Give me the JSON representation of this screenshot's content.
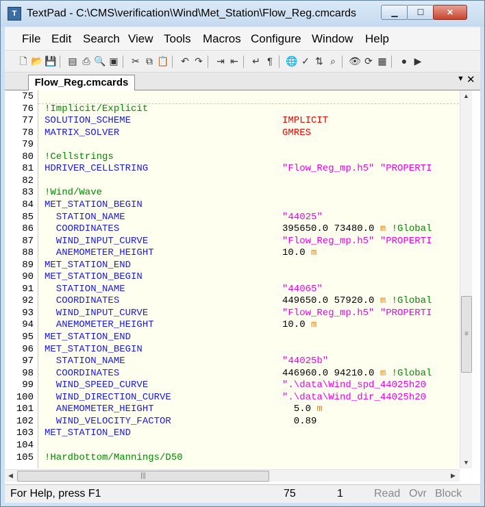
{
  "window": {
    "title": "TextPad - C:\\CMS\\verification\\Wind\\Met_Station\\Flow_Reg.cmcards",
    "icon": "textpad-app-icon",
    "caption_buttons": [
      "minimize",
      "maximize",
      "close"
    ]
  },
  "menu": [
    "File",
    "Edit",
    "Search",
    "View",
    "Tools",
    "Macros",
    "Configure",
    "Window",
    "Help"
  ],
  "toolbar_icons": [
    "new-file-icon",
    "open-icon",
    "save-icon",
    "save-all-icon",
    "print-icon",
    "print-preview-icon",
    "manage-files-icon",
    "cut-icon",
    "copy-icon",
    "paste-icon",
    "undo-icon",
    "redo-icon",
    "indent-icon",
    "outdent-icon",
    "word-wrap-icon",
    "paragraph-icon",
    "web-icon",
    "spell-check-icon",
    "sort-icon",
    "find-in-files-icon",
    "compare-icon",
    "replace-icon",
    "macro-icon",
    "record-macro-icon",
    "play-macro-icon"
  ],
  "tab": {
    "label": "Flow_Reg.cmcards"
  },
  "editor": {
    "lines": [
      {
        "n": "75",
        "parts": []
      },
      {
        "n": "76",
        "parts": [
          {
            "t": "!Implicit/Explicit",
            "c": "cm"
          }
        ]
      },
      {
        "n": "77",
        "parts": [
          {
            "t": "SOLUTION_SCHEME",
            "c": "kw"
          }
        ],
        "value": [
          {
            "t": "IMPLICIT",
            "c": "red"
          }
        ]
      },
      {
        "n": "78",
        "parts": [
          {
            "t": "MATRIX_SOLVER",
            "c": "kw"
          }
        ],
        "value": [
          {
            "t": "GMRES",
            "c": "red"
          }
        ]
      },
      {
        "n": "79",
        "parts": []
      },
      {
        "n": "80",
        "parts": [
          {
            "t": "!Cellstrings",
            "c": "cm"
          }
        ]
      },
      {
        "n": "81",
        "parts": [
          {
            "t": "HDRIVER_CELLSTRING",
            "c": "kw"
          }
        ],
        "value": [
          {
            "t": "\"Flow_Reg_mp.h5\" \"PROPERTI",
            "c": "str"
          }
        ]
      },
      {
        "n": "82",
        "parts": []
      },
      {
        "n": "83",
        "parts": [
          {
            "t": "!Wind/Wave",
            "c": "cm"
          }
        ]
      },
      {
        "n": "84",
        "parts": [
          {
            "t": "MET_STATION_BEGIN",
            "c": "kw"
          }
        ]
      },
      {
        "n": "85",
        "parts": [
          {
            "t": "  STATION_NAME",
            "c": "kw"
          }
        ],
        "value": [
          {
            "t": "\"44025\"",
            "c": "str"
          }
        ]
      },
      {
        "n": "86",
        "parts": [
          {
            "t": "  COORDINATES",
            "c": "kw"
          }
        ],
        "value": [
          {
            "t": "395650.0 73480.0 ",
            "c": "num"
          },
          {
            "t": "m",
            "c": "unit"
          },
          {
            "t": " !Global",
            "c": "cm"
          }
        ]
      },
      {
        "n": "87",
        "parts": [
          {
            "t": "  WIND_INPUT_CURVE",
            "c": "kw"
          }
        ],
        "value": [
          {
            "t": "\"Flow_Reg_mp.h5\" \"PROPERTI",
            "c": "str"
          }
        ]
      },
      {
        "n": "88",
        "parts": [
          {
            "t": "  ANEMOMETER_HEIGHT",
            "c": "kw"
          }
        ],
        "value": [
          {
            "t": "10.0 ",
            "c": "num"
          },
          {
            "t": "m",
            "c": "unit"
          }
        ]
      },
      {
        "n": "89",
        "parts": [
          {
            "t": "MET_STATION_END",
            "c": "kw"
          }
        ]
      },
      {
        "n": "90",
        "parts": [
          {
            "t": "MET_STATION_BEGIN",
            "c": "kw"
          }
        ]
      },
      {
        "n": "91",
        "parts": [
          {
            "t": "  STATION_NAME",
            "c": "kw"
          }
        ],
        "value": [
          {
            "t": "\"44065\"",
            "c": "str"
          }
        ]
      },
      {
        "n": "92",
        "parts": [
          {
            "t": "  COORDINATES",
            "c": "kw"
          }
        ],
        "value": [
          {
            "t": "449650.0 57920.0 ",
            "c": "num"
          },
          {
            "t": "m",
            "c": "unit"
          },
          {
            "t": " !Global",
            "c": "cm"
          }
        ]
      },
      {
        "n": "93",
        "parts": [
          {
            "t": "  WIND_INPUT_CURVE",
            "c": "kw"
          }
        ],
        "value": [
          {
            "t": "\"Flow_Reg_mp.h5\" \"PROPERTI",
            "c": "str"
          }
        ]
      },
      {
        "n": "94",
        "parts": [
          {
            "t": "  ANEMOMETER_HEIGHT",
            "c": "kw"
          }
        ],
        "value": [
          {
            "t": "10.0 ",
            "c": "num"
          },
          {
            "t": "m",
            "c": "unit"
          }
        ]
      },
      {
        "n": "95",
        "parts": [
          {
            "t": "MET_STATION_END",
            "c": "kw"
          }
        ]
      },
      {
        "n": "96",
        "parts": [
          {
            "t": "MET_STATION_BEGIN",
            "c": "kw"
          }
        ]
      },
      {
        "n": "97",
        "parts": [
          {
            "t": "  STATION_NAME",
            "c": "kw"
          }
        ],
        "value": [
          {
            "t": "\"44025b\"",
            "c": "str"
          }
        ]
      },
      {
        "n": "98",
        "parts": [
          {
            "t": "  COORDINATES",
            "c": "kw"
          }
        ],
        "value": [
          {
            "t": "446960.0 94210.0 ",
            "c": "num"
          },
          {
            "t": "m",
            "c": "unit"
          },
          {
            "t": " !Global",
            "c": "cm"
          }
        ]
      },
      {
        "n": "99",
        "parts": [
          {
            "t": "  WIND_SPEED_CURVE",
            "c": "kw"
          }
        ],
        "value": [
          {
            "t": "\".\\data\\Wind_spd_44025h20",
            "c": "str"
          }
        ]
      },
      {
        "n": "100",
        "parts": [
          {
            "t": "  WIND_DIRECTION_CURVE",
            "c": "kw"
          }
        ],
        "value": [
          {
            "t": "\".\\data\\Wind_dir_44025h20",
            "c": "str"
          }
        ]
      },
      {
        "n": "101",
        "parts": [
          {
            "t": "  ANEMOMETER_HEIGHT",
            "c": "kw"
          }
        ],
        "value": [
          {
            "t": "  5.0 ",
            "c": "num"
          },
          {
            "t": "m",
            "c": "unit"
          }
        ]
      },
      {
        "n": "102",
        "parts": [
          {
            "t": "  WIND_VELOCITY_FACTOR",
            "c": "kw"
          }
        ],
        "value": [
          {
            "t": "  0.89",
            "c": "num"
          }
        ]
      },
      {
        "n": "103",
        "parts": [
          {
            "t": "MET_STATION_END",
            "c": "kw"
          }
        ]
      },
      {
        "n": "104",
        "parts": []
      },
      {
        "n": "105",
        "parts": [
          {
            "t": "!Hardbottom/Mannings/D50",
            "c": "cm"
          }
        ]
      }
    ]
  },
  "status": {
    "help": "For Help, press F1",
    "line": "75",
    "column": "1",
    "read": "Read",
    "ovr": "Ovr",
    "block": "Block"
  }
}
